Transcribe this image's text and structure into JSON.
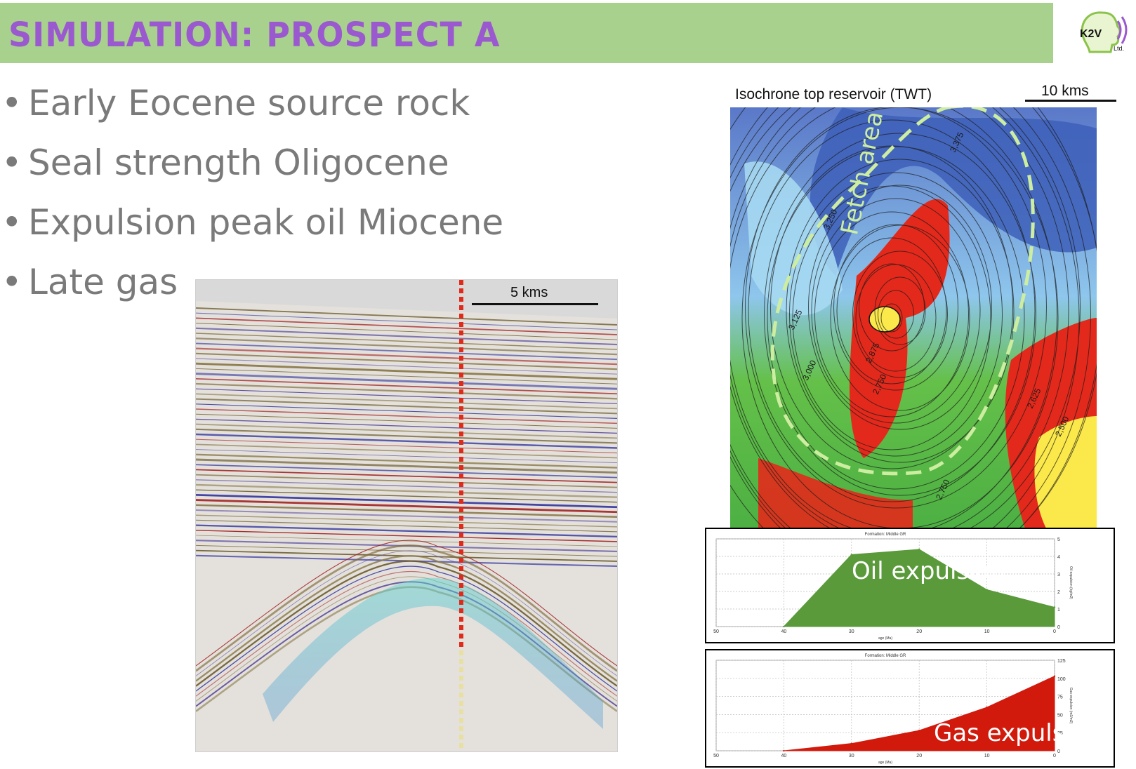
{
  "slide": {
    "title": "SIMULATION: PROSPECT A",
    "logo": {
      "text": "K2V",
      "sub": "Ltd."
    },
    "bullets": [
      "Early Eocene source rock",
      "Seal strength Oligocene",
      "Expulsion peak oil Miocene",
      "Late gas"
    ],
    "bullet_glyph": "•"
  },
  "seismic": {
    "scale_label": "5 kms",
    "colors": {
      "well_line": "#e02a1a",
      "background": "#e4e1dc"
    }
  },
  "map": {
    "title": "Isochrone top reservoir (TWT)",
    "scale_label": "10 kms",
    "fetch_label": "Fetch area",
    "contour_labels": [
      "3,125",
      "3,250",
      "3,375",
      "3,000",
      "2,875",
      "2,750",
      "2,625",
      "2,500",
      "2,750"
    ],
    "colors": {
      "deep": "#4a6fc6",
      "mid": "#5cbf46",
      "shallow": "#e3291b",
      "crest": "#fbe84a",
      "fetch": "#cdeea0"
    }
  },
  "chart_data": [
    {
      "type": "area",
      "title": "Formation: Middle GR",
      "overlay_label": "Oil expulsion",
      "xlabel": "age (Ma)",
      "ylabel": "Oil expulsion (kg/m2)",
      "x_ticks": [
        50,
        40,
        30,
        20,
        10,
        0
      ],
      "y_ticks": [
        0,
        1,
        2,
        3,
        4,
        5
      ],
      "xlim": [
        50,
        0
      ],
      "ylim": [
        0,
        5
      ],
      "x": [
        40,
        30,
        20,
        10,
        0
      ],
      "values": [
        0,
        4.1,
        4.4,
        2.1,
        1.1
      ],
      "color": "#5a9a3a",
      "grid": true
    },
    {
      "type": "area",
      "title": "Formation: Middle GR",
      "overlay_label": "Gas expulsion",
      "xlabel": "age (Ma)",
      "ylabel": "Gas expulsion (m3/m2)",
      "x_ticks": [
        50,
        40,
        30,
        20,
        10,
        0
      ],
      "y_ticks": [
        0,
        25,
        50,
        75,
        100,
        125
      ],
      "xlim": [
        50,
        0
      ],
      "ylim": [
        0,
        125
      ],
      "x": [
        40,
        30,
        20,
        10,
        0
      ],
      "values": [
        0,
        10,
        28,
        60,
        103
      ],
      "color": "#d11a0c",
      "grid": true
    }
  ]
}
